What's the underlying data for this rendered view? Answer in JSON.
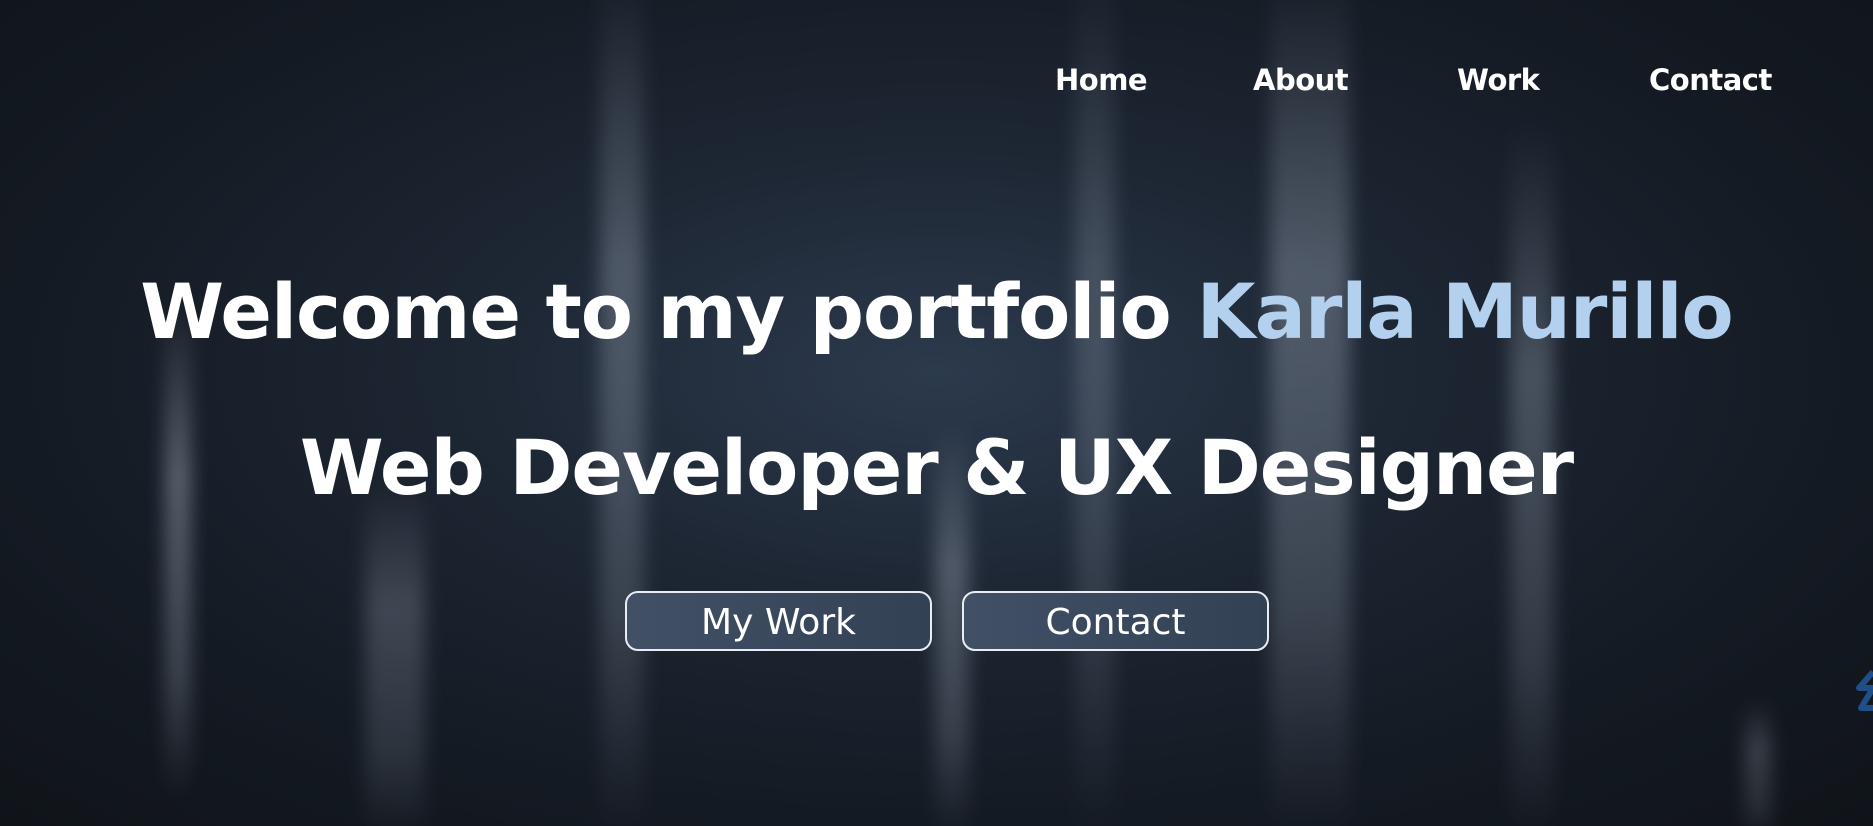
{
  "nav": {
    "items": [
      {
        "label": "Home"
      },
      {
        "label": "About"
      },
      {
        "label": "Work"
      },
      {
        "label": "Contact"
      }
    ]
  },
  "hero": {
    "welcome": "Welcome to my portfolio",
    "name": "Karla Murillo",
    "role": "Web Developer & UX Designer",
    "buttons": {
      "work_label": "My Work",
      "contact_label": "Contact"
    }
  },
  "colors": {
    "background": "#141a23",
    "text": "#ffffff",
    "accent_name": "#b3d0ee",
    "button_fill": "#3a475c",
    "button_border": "#e8edf3"
  },
  "icons": {
    "edge_icon": "partial-arrow-icon"
  }
}
